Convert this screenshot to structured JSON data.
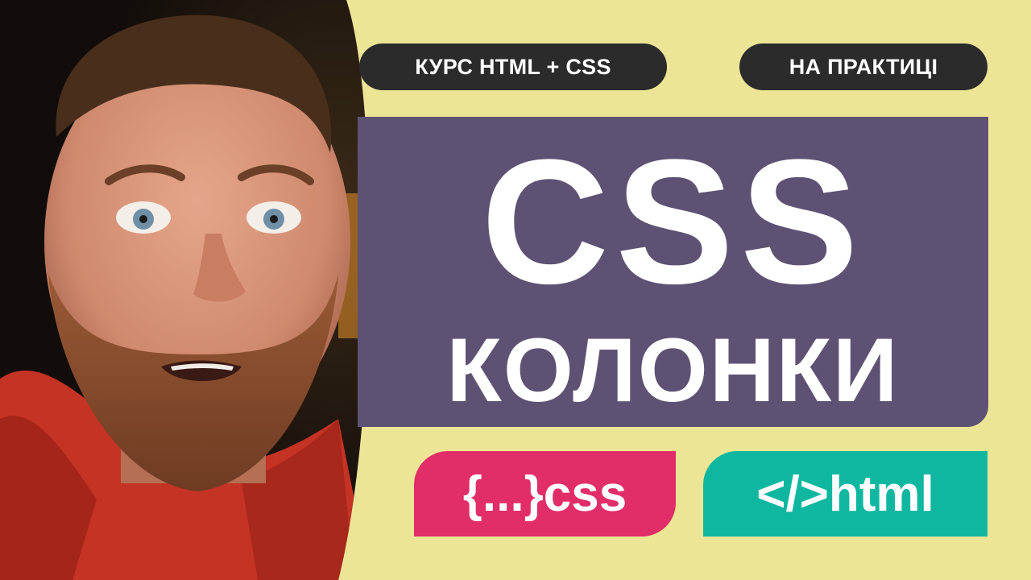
{
  "pills": {
    "course": "КУРС HTML + CSS",
    "practice": "НА ПРАКТИЦІ"
  },
  "title": {
    "main": "CSS",
    "sub": "КОЛОНКИ"
  },
  "tags": {
    "css": "{...}css",
    "html": "</>html"
  },
  "colors": {
    "background": "#ede596",
    "pill": "#2b2b2b",
    "title_block": "#5e5274",
    "css_tag": "#e12d68",
    "html_tag": "#10b7a0"
  }
}
